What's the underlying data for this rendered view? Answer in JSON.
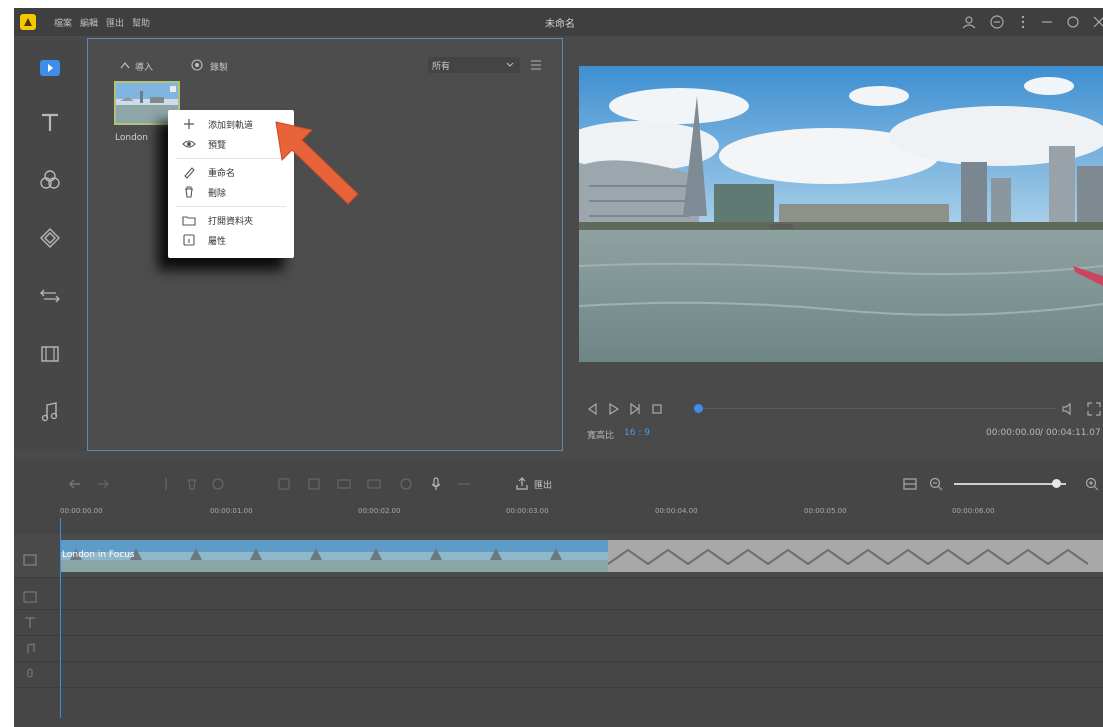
{
  "titlebar": {
    "title": "未命名",
    "menus": [
      "檔案",
      "編輯",
      "匯出",
      "幫助"
    ]
  },
  "media": {
    "import_label": "導入",
    "record_label": "錄製",
    "filter_value": "所有",
    "clip_label": "London"
  },
  "context_menu": {
    "items": [
      "添加到軌道",
      "預覽",
      "重命名",
      "刪除",
      "打開資料夾",
      "屬性"
    ]
  },
  "preview": {
    "aspect_label": "寬高比",
    "aspect_value": "16 : 9",
    "time_current": "00:00:00.00",
    "time_total": "00:04:11.07",
    "playback_progress": 0
  },
  "timeline": {
    "export_label": "匯出",
    "ruler": [
      "00:00:00.00",
      "00:00:01.00",
      "00:00:02.00",
      "00:00:03.00",
      "00:00:04.00",
      "00:00:05.00",
      "00:00:06.00"
    ],
    "clip_title": "London in Focus",
    "zoom_level": 0.9
  },
  "icons": {
    "accent": "#3d8ee8",
    "arrow_color": "#e8623a"
  }
}
